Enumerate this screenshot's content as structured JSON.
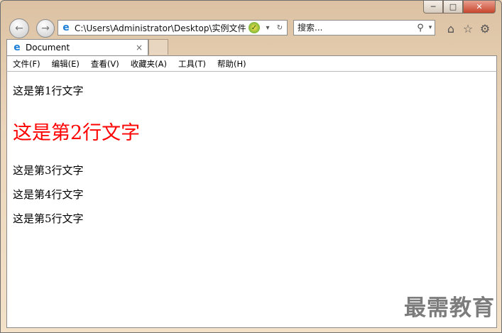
{
  "window": {
    "minimize_label": "─",
    "maximize_label": "□",
    "close_label": "✕"
  },
  "nav": {
    "back_icon": "←",
    "forward_icon": "→"
  },
  "address": {
    "icon": "e",
    "url": "C:\\Users\\Administrator\\Desktop\\实例文件",
    "dropdown": "▾",
    "refresh": "↻"
  },
  "search": {
    "placeholder": "搜索...",
    "icon": "⚲",
    "dropdown": "▾"
  },
  "toolbar": {
    "home_icon": "⌂",
    "favorites_icon": "☆",
    "tools_icon": "⚙"
  },
  "tab": {
    "icon": "e",
    "title": "Document",
    "close": "×"
  },
  "menu": {
    "items": [
      "文件(F)",
      "编辑(E)",
      "查看(V)",
      "收藏夹(A)",
      "工具(T)",
      "帮助(H)"
    ]
  },
  "content": {
    "lines": [
      "这是第1行文字",
      "这是第2行文字",
      "这是第3行文字",
      "这是第4行文字",
      "这是第5行文字"
    ],
    "highlight_color": "#ff0000"
  },
  "watermark": "最需教育"
}
